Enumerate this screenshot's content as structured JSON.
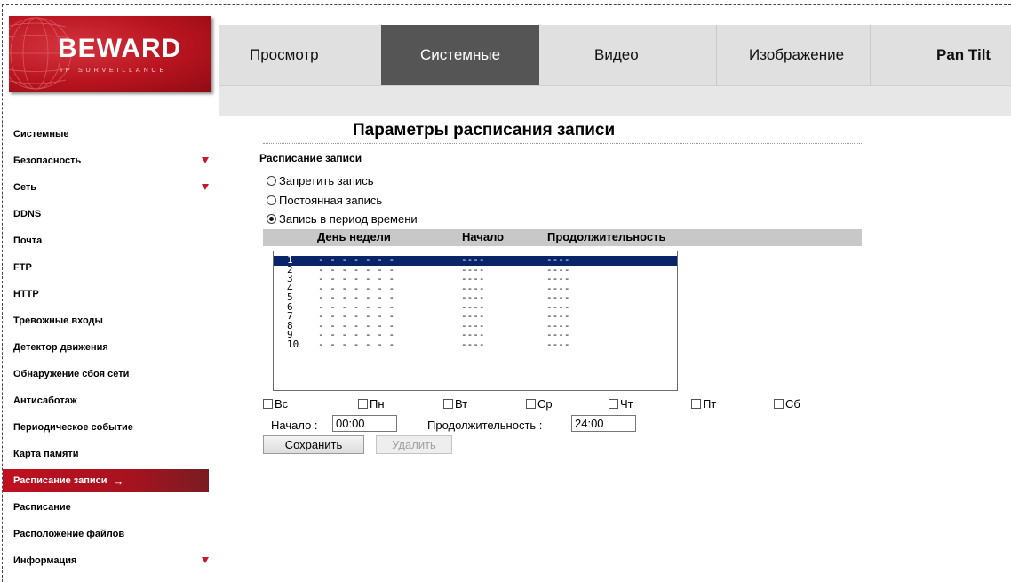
{
  "logo": {
    "brand": "BEWARD",
    "tagline": "IP SURVEILLANCE"
  },
  "nav": {
    "tabs": [
      {
        "label": "Просмотр",
        "active": false
      },
      {
        "label": "Системные",
        "active": true
      },
      {
        "label": "Видео",
        "active": false
      },
      {
        "label": "Изображение",
        "active": false
      },
      {
        "label": "Pan Tilt",
        "active": false
      }
    ]
  },
  "sidebar": {
    "items": [
      {
        "label": "Системные",
        "has_submenu": false,
        "active": false
      },
      {
        "label": "Безопасность",
        "has_submenu": true,
        "active": false
      },
      {
        "label": "Сеть",
        "has_submenu": true,
        "active": false
      },
      {
        "label": "DDNS",
        "has_submenu": false,
        "active": false
      },
      {
        "label": "Почта",
        "has_submenu": false,
        "active": false
      },
      {
        "label": "FTP",
        "has_submenu": false,
        "active": false
      },
      {
        "label": "HTTP",
        "has_submenu": false,
        "active": false
      },
      {
        "label": "Тревожные входы",
        "has_submenu": false,
        "active": false
      },
      {
        "label": "Детектор движения",
        "has_submenu": false,
        "active": false
      },
      {
        "label": "Обнаружение сбоя сети",
        "has_submenu": false,
        "active": false
      },
      {
        "label": "Антисаботаж",
        "has_submenu": false,
        "active": false
      },
      {
        "label": "Периодическое событие",
        "has_submenu": false,
        "active": false
      },
      {
        "label": "Карта памяти",
        "has_submenu": false,
        "active": false
      },
      {
        "label": "Расписание записи",
        "has_submenu": false,
        "active": true,
        "indicator": "→"
      },
      {
        "label": "Расписание",
        "has_submenu": false,
        "active": false
      },
      {
        "label": "Расположение файлов",
        "has_submenu": false,
        "active": false
      },
      {
        "label": "Информация",
        "has_submenu": true,
        "active": false
      }
    ]
  },
  "main": {
    "title": "Параметры расписания записи",
    "section_label": "Расписание записи",
    "record_modes": [
      {
        "label": "Запретить запись",
        "checked": false
      },
      {
        "label": "Постоянная запись",
        "checked": false
      },
      {
        "label": "Запись в период времени",
        "checked": true
      }
    ],
    "table_headers": {
      "day": "День недели",
      "start": "Начало",
      "duration": "Продолжительность"
    },
    "schedule_rows": [
      {
        "n": "1",
        "days": "- - - - - - -",
        "start": "----",
        "duration": "----",
        "selected": true
      },
      {
        "n": "2",
        "days": "- - - - - - -",
        "start": "----",
        "duration": "----",
        "selected": false
      },
      {
        "n": "3",
        "days": "- - - - - - -",
        "start": "----",
        "duration": "----",
        "selected": false
      },
      {
        "n": "4",
        "days": "- - - - - - -",
        "start": "----",
        "duration": "----",
        "selected": false
      },
      {
        "n": "5",
        "days": "- - - - - - -",
        "start": "----",
        "duration": "----",
        "selected": false
      },
      {
        "n": "6",
        "days": "- - - - - - -",
        "start": "----",
        "duration": "----",
        "selected": false
      },
      {
        "n": "7",
        "days": "- - - - - - -",
        "start": "----",
        "duration": "----",
        "selected": false
      },
      {
        "n": "8",
        "days": "- - - - - - -",
        "start": "----",
        "duration": "----",
        "selected": false
      },
      {
        "n": "9",
        "days": "- - - - - - -",
        "start": "----",
        "duration": "----",
        "selected": false
      },
      {
        "n": "10",
        "days": "- - - - - - -",
        "start": "----",
        "duration": "----",
        "selected": false
      }
    ],
    "weekdays": [
      "Вс",
      "Пн",
      "Вт",
      "Ср",
      "Чт",
      "Пт",
      "Сб"
    ],
    "start_label": "Начало :",
    "start_value": "00:00",
    "duration_label": "Продолжительность :",
    "duration_value": "24:00",
    "save_label": "Сохранить",
    "delete_label": "Удалить"
  },
  "colors": {
    "accent_red": "#c01020",
    "nav_active": "#555555",
    "header_bar": "#e0e0e0",
    "selection": "#0a246a"
  }
}
